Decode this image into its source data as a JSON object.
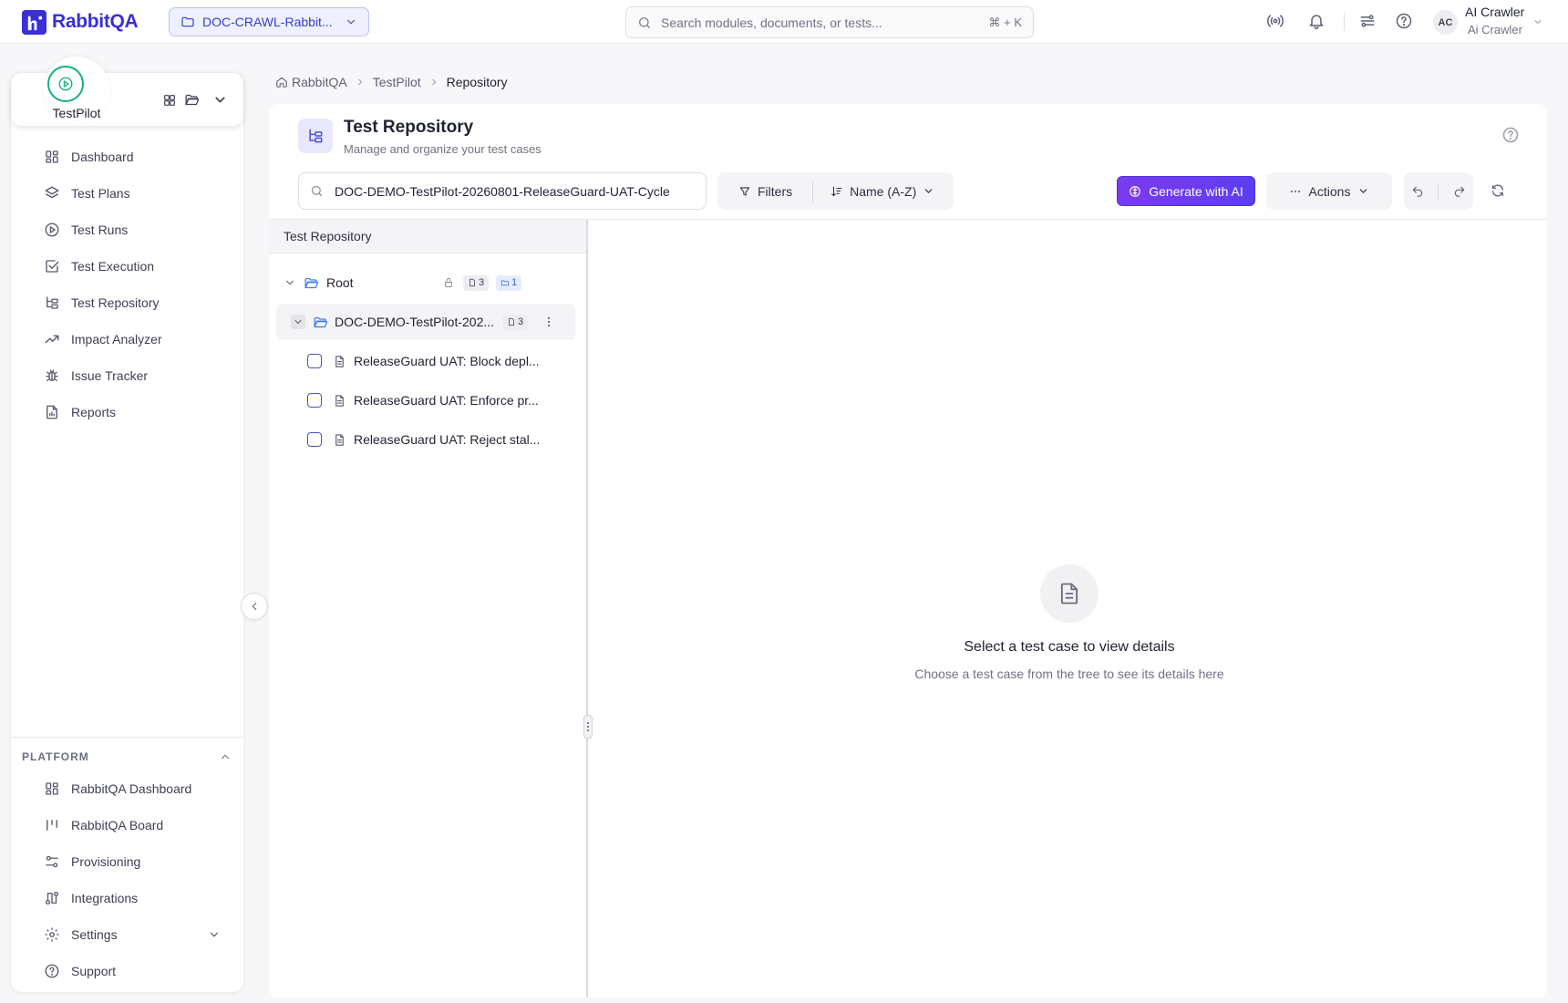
{
  "app": {
    "name": "RabbitQA",
    "brand_color": "#3b2fd6"
  },
  "topbar": {
    "project": "DOC-CRAWL-Rabbit...",
    "search_placeholder": "Search modules, documents, or tests...",
    "search_shortcut": "⌘ + K",
    "user_initials": "AC",
    "user_name": "AI Crawler",
    "user_sub": "Ai Crawler"
  },
  "sidebar": {
    "module_name": "TestPilot",
    "items": [
      {
        "label": "Dashboard",
        "icon": "grid-icon"
      },
      {
        "label": "Test Plans",
        "icon": "layers-icon"
      },
      {
        "label": "Test Runs",
        "icon": "play-circle-icon"
      },
      {
        "label": "Test Execution",
        "icon": "check-square-icon"
      },
      {
        "label": "Test Repository",
        "icon": "tree-icon"
      },
      {
        "label": "Impact Analyzer",
        "icon": "trend-icon"
      },
      {
        "label": "Issue Tracker",
        "icon": "bug-icon"
      },
      {
        "label": "Reports",
        "icon": "report-icon"
      }
    ],
    "platform_title": "PLATFORM",
    "platform_items": [
      {
        "label": "RabbitQA Dashboard",
        "icon": "grid-icon"
      },
      {
        "label": "RabbitQA Board",
        "icon": "board-icon"
      },
      {
        "label": "Provisioning",
        "icon": "sliders-icon"
      },
      {
        "label": "Integrations",
        "icon": "integrations-icon"
      },
      {
        "label": "Settings",
        "icon": "gear-icon"
      },
      {
        "label": "Support",
        "icon": "help-icon"
      }
    ]
  },
  "breadcrumb": {
    "home": "RabbitQA",
    "module": "TestPilot",
    "current": "Repository"
  },
  "page": {
    "title": "Test Repository",
    "subtitle": "Manage and organize your test cases",
    "search_value": "DOC-DEMO-TestPilot-20260801-ReleaseGuard-UAT-Cycle",
    "filters_label": "Filters",
    "sort_label": "Name (A-Z)",
    "generate_label": "Generate with AI",
    "actions_label": "Actions"
  },
  "tree": {
    "header": "Test Repository",
    "root": {
      "label": "Root",
      "doc_count": "3",
      "folder_count": "1"
    },
    "folder": {
      "label": "DOC-DEMO-TestPilot-202...",
      "doc_count": "3"
    },
    "cases": [
      "ReleaseGuard UAT: Block depl...",
      "ReleaseGuard UAT: Enforce pr...",
      "ReleaseGuard UAT: Reject stal..."
    ]
  },
  "empty_state": {
    "title": "Select a test case to view details",
    "subtitle": "Choose a test case from the tree to see its details here"
  }
}
